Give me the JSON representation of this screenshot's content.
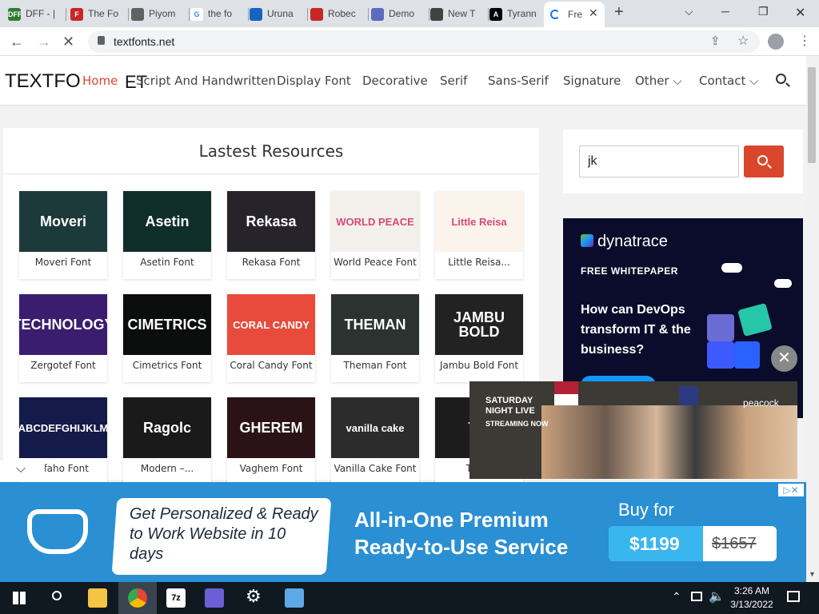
{
  "browser": {
    "tabs": [
      {
        "title": "DFF - |",
        "fav": "DFF",
        "color": "#2e7d32"
      },
      {
        "title": "The Fo",
        "fav": "F",
        "color": "#c62828"
      },
      {
        "title": "Piyom",
        "fav": "",
        "color": "#616161"
      },
      {
        "title": "the fo",
        "fav": "G",
        "color": "#ffffff"
      },
      {
        "title": "Uruna",
        "fav": "",
        "color": "#1565c0"
      },
      {
        "title": "Robec",
        "fav": "",
        "color": "#c62828"
      },
      {
        "title": "Demo",
        "fav": "",
        "color": "#5c6bc0"
      },
      {
        "title": "New T",
        "fav": "",
        "color": "#424242"
      },
      {
        "title": "Tyrann",
        "fav": "A",
        "color": "#000000"
      }
    ],
    "active_tab": {
      "title": "Fre"
    },
    "new_tab": "+",
    "url": "textfonts.net"
  },
  "site": {
    "logo": "TEXTFO",
    "logo_tail": "ET",
    "nav": [
      {
        "label": "Home",
        "active": true
      },
      {
        "label": "Script And Handwritten"
      },
      {
        "label": "Display Font"
      },
      {
        "label": "Decorative"
      },
      {
        "label": "Serif"
      },
      {
        "label": "Sans-Serif"
      },
      {
        "label": "Signature"
      },
      {
        "label": "Other ⌵"
      },
      {
        "label": "Contact ⌵"
      }
    ],
    "accent": "#d9462b"
  },
  "resources": {
    "title": "Lastest Resources",
    "items": [
      {
        "label": "Moveri Font",
        "art": "Moveri",
        "bg": "#1d3a3a"
      },
      {
        "label": "Asetin Font",
        "art": "Asetin",
        "bg": "#0f2e2a"
      },
      {
        "label": "Rekasa Font",
        "art": "Rekasa",
        "bg": "#26242a"
      },
      {
        "label": "World Peace Font",
        "art": "WORLD PEACE",
        "bg": "#f3f0ec"
      },
      {
        "label": "Little Reisa...",
        "art": "Little Reisa",
        "bg": "#fbf4ec"
      },
      {
        "label": "Zergotef Font",
        "art": "TECHNOLOGY",
        "bg": "#3a1d6e"
      },
      {
        "label": "Cimetrics Font",
        "art": "CIMETRICS",
        "bg": "#0c0d0d"
      },
      {
        "label": "Coral Candy Font",
        "art": "CORAL CANDY",
        "bg": "#e84a3c"
      },
      {
        "label": "Theman Font",
        "art": "THEMAN",
        "bg": "#2b3230"
      },
      {
        "label": "Jambu Bold Font",
        "art": "JAMBU BOLD",
        "bg": "#222222"
      },
      {
        "label": "efaho Font",
        "art": "ABCDEFGHIJKLM",
        "bg": "#141a4a"
      },
      {
        "label": "Modern –...",
        "art": "Ragolc",
        "bg": "#1a1a1a"
      },
      {
        "label": "Vaghem Font",
        "art": "GHEREM",
        "bg": "#2a1216"
      },
      {
        "label": "Vanilla Cake Font",
        "art": "vanilla cake",
        "bg": "#2c2c2c"
      },
      {
        "label": "Trapo",
        "art": "Tra",
        "bg": "#1c1c1c"
      }
    ]
  },
  "search": {
    "value": "jk"
  },
  "ad_side": {
    "brand": "dynatrace",
    "tag": "FREE WHITEPAPER",
    "headline": "How can DevOps transform IT & the business?"
  },
  "video": {
    "show": "SATURDAY NIGHT LIVE",
    "sub": "STREAMING NOW",
    "network": "peacock"
  },
  "banner": {
    "left": "Get Personalized & Ready to Work Website in 10 days",
    "middle": "All-in-One Premium Ready-to-Use Service",
    "buy": "Buy for",
    "price": "$1199",
    "old_price": "$1657"
  },
  "taskbar": {
    "time": "3:26 AM",
    "date": "3/13/2022"
  }
}
